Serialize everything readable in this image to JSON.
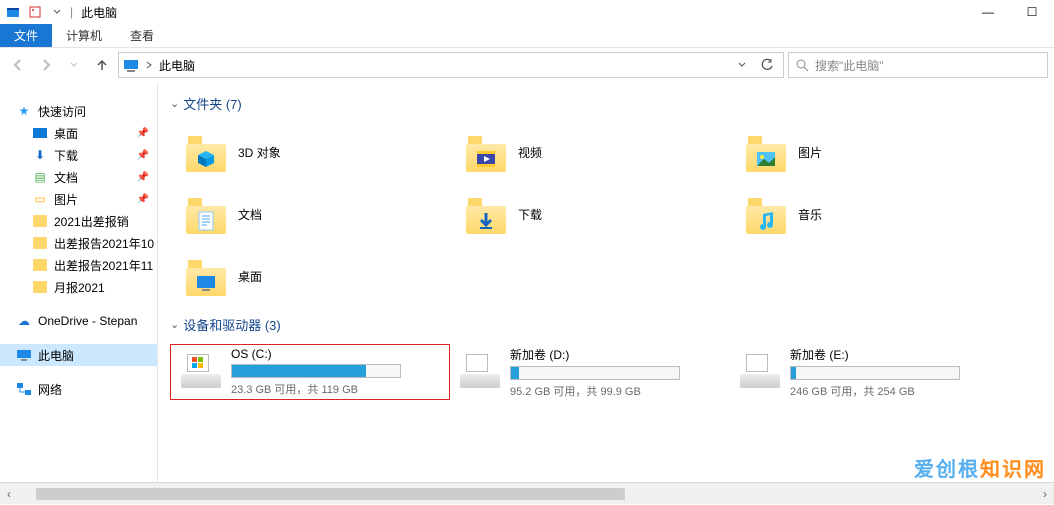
{
  "title": {
    "separator": "|",
    "text": "此电脑"
  },
  "window_controls": {
    "minimize": "—",
    "maximize": "☐"
  },
  "ribbon": {
    "file": "文件",
    "computer": "计算机",
    "view": "查看"
  },
  "address": {
    "crumb": "此电脑",
    "dropdown_icon": "chevron-down-icon",
    "refresh_icon": "refresh-icon"
  },
  "search": {
    "placeholder": "搜索\"此电脑\""
  },
  "sidebar": {
    "quick_access": "快速访问",
    "items": [
      {
        "label": "桌面",
        "pinned": true
      },
      {
        "label": "下载",
        "pinned": true
      },
      {
        "label": "文档",
        "pinned": true
      },
      {
        "label": "图片",
        "pinned": true
      },
      {
        "label": "2021出差报销",
        "pinned": false
      },
      {
        "label": "出差报告2021年10",
        "pinned": false
      },
      {
        "label": "出差报告2021年11",
        "pinned": false
      },
      {
        "label": "月报2021",
        "pinned": false
      }
    ],
    "onedrive": "OneDrive - Stepan",
    "this_pc": "此电脑",
    "network": "网络"
  },
  "sections": {
    "folders_header": "文件夹 (7)",
    "drives_header": "设备和驱动器 (3)"
  },
  "folders": [
    {
      "label": "3D 对象",
      "overlay": "cube"
    },
    {
      "label": "视频",
      "overlay": "video"
    },
    {
      "label": "图片",
      "overlay": "picture"
    },
    {
      "label": "文档",
      "overlay": "document"
    },
    {
      "label": "下载",
      "overlay": "download"
    },
    {
      "label": "音乐",
      "overlay": "music"
    },
    {
      "label": "桌面",
      "overlay": "desktop"
    }
  ],
  "drives": [
    {
      "name": "OS (C:)",
      "stats": "23.3 GB 可用，共 119 GB",
      "fill_pct": 80,
      "highlighted": true,
      "icon": "win"
    },
    {
      "name": "新加卷 (D:)",
      "stats": "95.2 GB 可用，共 99.9 GB",
      "fill_pct": 5,
      "highlighted": false,
      "icon": "blank"
    },
    {
      "name": "新加卷 (E:)",
      "stats": "246 GB 可用，共 254 GB",
      "fill_pct": 3,
      "highlighted": false,
      "icon": "blank"
    }
  ],
  "watermark": {
    "a": "爱创根",
    "b": "知识网"
  }
}
